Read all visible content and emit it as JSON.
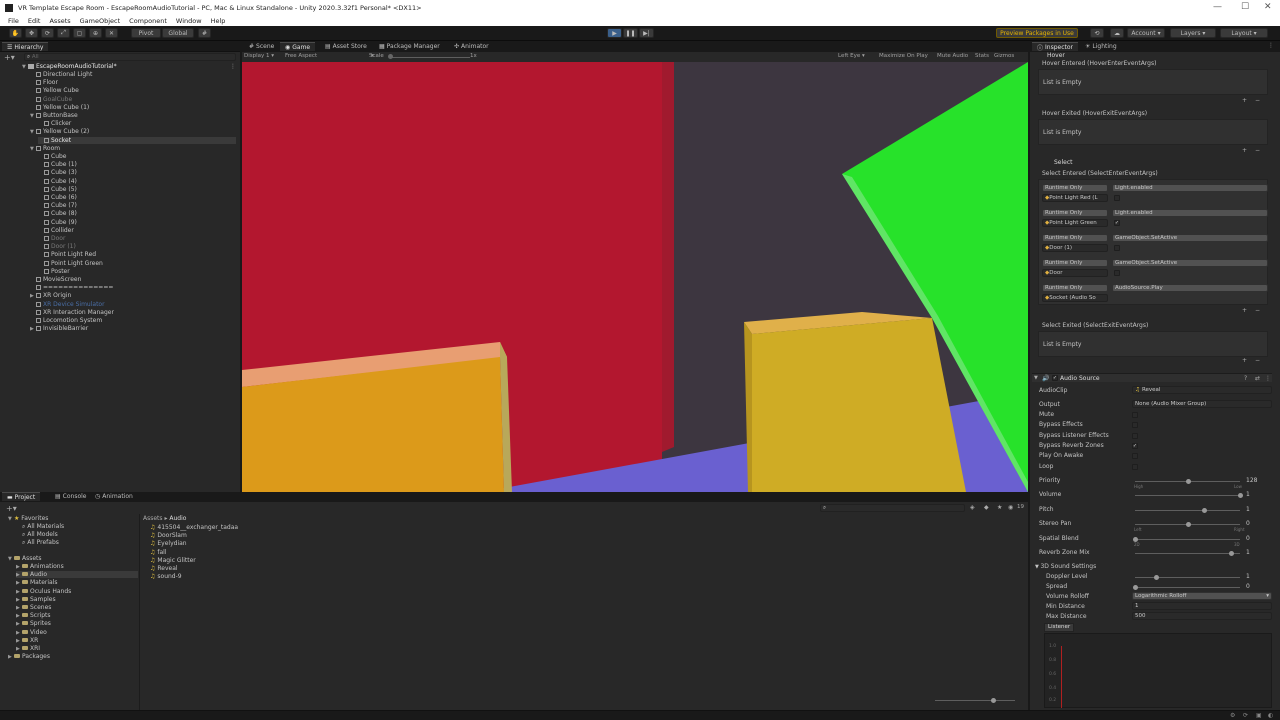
{
  "window": {
    "title": "VR Template Escape Room - EscapeRoomAudioTutorial - PC, Mac & Linux Standalone - Unity 2020.3.32f1 Personal* <DX11>"
  },
  "menu": [
    "File",
    "Edit",
    "Assets",
    "GameObject",
    "Component",
    "Window",
    "Help"
  ],
  "toolbar": {
    "pivot": "Pivot",
    "global": "Global",
    "preview_packages": "Preview Packages in Use",
    "account": "Account",
    "layers": "Layers",
    "layout": "Layout"
  },
  "hierarchy": {
    "tab": "Hierarchy",
    "search_placeholder": "All",
    "scene": "EscapeRoomAudioTutorial*",
    "items": [
      {
        "label": "Directional Light",
        "depth": 1,
        "dim": false
      },
      {
        "label": "Floor",
        "depth": 1,
        "dim": false
      },
      {
        "label": "Yellow Cube",
        "depth": 1,
        "dim": false
      },
      {
        "label": "GoalCube",
        "depth": 1,
        "dim": true
      },
      {
        "label": "Yellow Cube (1)",
        "depth": 1,
        "dim": false
      },
      {
        "label": "ButtonBase",
        "depth": 1,
        "dim": false,
        "expanded": true
      },
      {
        "label": "Clicker",
        "depth": 2,
        "dim": false
      },
      {
        "label": "Yellow Cube (2)",
        "depth": 1,
        "dim": false,
        "expanded": true
      },
      {
        "label": "Socket",
        "depth": 2,
        "dim": false,
        "selected": true
      },
      {
        "label": "Room",
        "depth": 1,
        "dim": false,
        "expanded": true
      },
      {
        "label": "Cube",
        "depth": 2,
        "dim": false
      },
      {
        "label": "Cube (1)",
        "depth": 2,
        "dim": false
      },
      {
        "label": "Cube (3)",
        "depth": 2,
        "dim": false
      },
      {
        "label": "Cube (4)",
        "depth": 2,
        "dim": false
      },
      {
        "label": "Cube (5)",
        "depth": 2,
        "dim": false
      },
      {
        "label": "Cube (6)",
        "depth": 2,
        "dim": false
      },
      {
        "label": "Cube (7)",
        "depth": 2,
        "dim": false
      },
      {
        "label": "Cube (8)",
        "depth": 2,
        "dim": false
      },
      {
        "label": "Cube (9)",
        "depth": 2,
        "dim": false
      },
      {
        "label": "Collider",
        "depth": 2,
        "dim": false
      },
      {
        "label": "Door",
        "depth": 2,
        "dim": true
      },
      {
        "label": "Door (1)",
        "depth": 2,
        "dim": true
      },
      {
        "label": "Point Light Red",
        "depth": 2,
        "dim": false
      },
      {
        "label": "Point Light Green",
        "depth": 2,
        "dim": false
      },
      {
        "label": "Poster",
        "depth": 2,
        "dim": false
      },
      {
        "label": "MovieScreen",
        "depth": 1,
        "dim": false
      },
      {
        "label": "==============",
        "depth": 1,
        "dim": false
      },
      {
        "label": "XR Origin",
        "depth": 1,
        "dim": false,
        "collapsed": true
      },
      {
        "label": "XR Device Simulator",
        "depth": 1,
        "dim": true,
        "blue": true
      },
      {
        "label": "XR Interaction Manager",
        "depth": 1,
        "dim": false
      },
      {
        "label": "Locomotion System",
        "depth": 1,
        "dim": false
      },
      {
        "label": "InvisibleBarrier",
        "depth": 1,
        "dim": false,
        "collapsed": true
      }
    ]
  },
  "center_tabs": [
    "Scene",
    "Game",
    "Asset Store",
    "Package Manager",
    "Animator"
  ],
  "game_toolbar": {
    "display": "Display 1",
    "aspect": "Free Aspect",
    "scale_label": "Scale",
    "scale_value": "1x",
    "eye": "Left Eye",
    "maximize": "Maximize On Play",
    "mute": "Mute Audio",
    "stats": "Stats",
    "gizmos": "Gizmos"
  },
  "bottom_tabs": [
    "Project",
    "Console",
    "Animation"
  ],
  "project": {
    "favorites": "Favorites",
    "fav_items": [
      "All Materials",
      "All Models",
      "All Prefabs"
    ],
    "assets": "Assets",
    "asset_folders": [
      "Animations",
      "Audio",
      "Materials",
      "Oculus Hands",
      "Samples",
      "Scenes",
      "Scripts",
      "Sprites",
      "Video",
      "XR",
      "XRI"
    ],
    "packages": "Packages",
    "breadcrumb_root": "Assets",
    "breadcrumb_leaf": "Audio",
    "files": [
      "415504__exchanger_tadaa",
      "DoorSlam",
      "Eyelydian",
      "fall",
      "Magic Glitter",
      "Reveal",
      "sound-9"
    ],
    "count": "19"
  },
  "inspector": {
    "tabs": [
      "Inspector",
      "Lighting"
    ],
    "hover_header": "Hover",
    "hover_entered": "Hover Entered (HoverEnterEventArgs)",
    "list_empty": "List is Empty",
    "hover_exited": "Hover Exited (HoverExitEventArgs)",
    "select_header": "Select",
    "select_entered": "Select Entered (SelectEnterEventArgs)",
    "events": [
      {
        "mode": "Runtime Only",
        "function": "Light.enabled",
        "target": "Point Light Red (L",
        "checked": false
      },
      {
        "mode": "Runtime Only",
        "function": "Light.enabled",
        "target": "Point Light Green",
        "checked": true
      },
      {
        "mode": "Runtime Only",
        "function": "GameObject.SetActive",
        "target": "Door (1)",
        "checked": false
      },
      {
        "mode": "Runtime Only",
        "function": "GameObject.SetActive",
        "target": "Door",
        "checked": false
      },
      {
        "mode": "Runtime Only",
        "function": "AudioSource.Play",
        "target": "Socket (Audio So",
        "checked": null
      }
    ],
    "select_exited": "Select Exited (SelectExitEventArgs)",
    "audio_source": {
      "title": "Audio Source",
      "audioclip_label": "AudioClip",
      "audioclip_value": "Reveal",
      "output_label": "Output",
      "output_value": "None (Audio Mixer Group)",
      "toggles": [
        {
          "label": "Mute",
          "checked": false
        },
        {
          "label": "Bypass Effects",
          "checked": false
        },
        {
          "label": "Bypass Listener Effects",
          "checked": false
        },
        {
          "label": "Bypass Reverb Zones",
          "checked": true
        },
        {
          "label": "Play On Awake",
          "checked": false
        },
        {
          "label": "Loop",
          "checked": false
        }
      ],
      "sliders": [
        {
          "label": "Priority",
          "value": "128",
          "fraction": 0.5,
          "left": "High",
          "right": "Low"
        },
        {
          "label": "Volume",
          "value": "1",
          "fraction": 1.0
        },
        {
          "label": "Pitch",
          "value": "1",
          "fraction": 0.66
        },
        {
          "label": "Stereo Pan",
          "value": "0",
          "fraction": 0.5,
          "left": "Left",
          "right": "Right"
        },
        {
          "label": "Spatial Blend",
          "value": "0",
          "fraction": 0.0,
          "left": "2D",
          "right": "3D"
        },
        {
          "label": "Reverb Zone Mix",
          "value": "1",
          "fraction": 0.91
        }
      ],
      "sound3d": "3D Sound Settings",
      "doppler_label": "Doppler Level",
      "doppler_value": "1",
      "doppler_fraction": 0.2,
      "spread_label": "Spread",
      "spread_value": "0",
      "rolloff_label": "Volume Rolloff",
      "rolloff_value": "Logarithmic Rolloff",
      "min_label": "Min Distance",
      "min_value": "1",
      "max_label": "Max Distance",
      "max_value": "500",
      "listener": "Listener",
      "graph_ticks": [
        "1.0",
        "0.8",
        "0.6",
        "0.4",
        "0.2"
      ]
    }
  },
  "colors": {
    "red_wall": "#b3172f",
    "green_cube": "#27e22a",
    "orange_cube": "#dc9a1a",
    "yellow_cube": "#cfac25",
    "floor": "#6a60d0"
  }
}
